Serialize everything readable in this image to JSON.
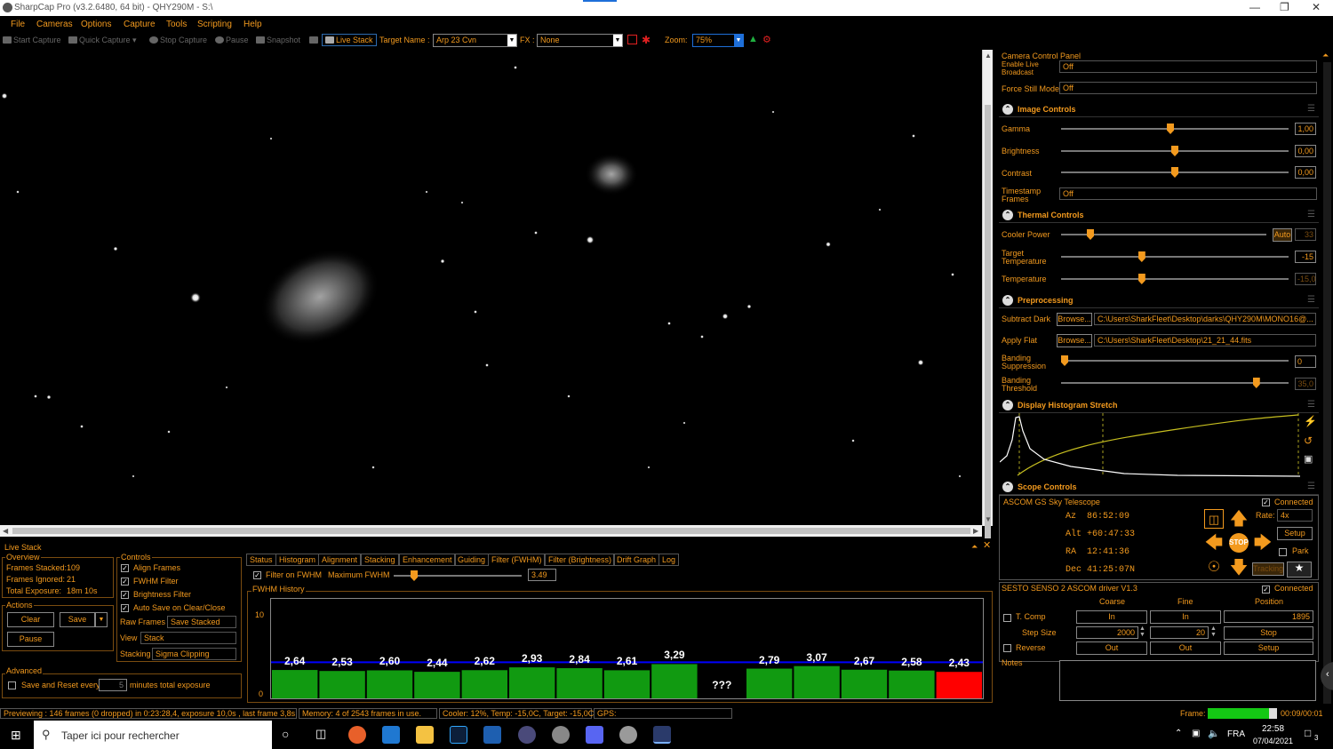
{
  "window": {
    "title": "SharpCap Pro (v3.2.6480, 64 bit) - QHY290M - S:\\"
  },
  "menu": [
    "File",
    "Cameras",
    "Options",
    "Capture",
    "Tools",
    "Scripting",
    "Help"
  ],
  "toolbar": {
    "start_capture": "Start Capture",
    "quick_capture": "Quick Capture",
    "stop_capture": "Stop Capture",
    "pause": "Pause",
    "snapshot": "Snapshot",
    "live_stack": "Live Stack",
    "target_label": "Target Name :",
    "target_value": "Arp 23 Cvn",
    "fx_label": "FX :",
    "fx_value": "None",
    "zoom_label": "Zoom:",
    "zoom_value": "75%"
  },
  "camera_panel": {
    "title": "Camera Control Panel",
    "live_broadcast_label": "Enable Live Broadcast",
    "live_broadcast_value": "Off",
    "force_still_label": "Force Still Mode",
    "force_still_value": "Off",
    "image_controls": {
      "title": "Image Controls",
      "gamma_label": "Gamma",
      "gamma_value": "1,00",
      "gamma_level": 0.48,
      "brightness_label": "Brightness",
      "brightness_value": "0,00",
      "brightness_level": 0.5,
      "contrast_label": "Contrast",
      "contrast_value": "0,00",
      "contrast_level": 0.5,
      "timestamp_label": "Timestamp Frames",
      "timestamp_value": "Off"
    },
    "thermal": {
      "title": "Thermal Controls",
      "cooler_label": "Cooler Power",
      "cooler_auto": "Auto",
      "cooler_value": "33",
      "cooler_level": 0.13,
      "target_label": "Target Temperature",
      "target_value": "-15",
      "target_level": 0.35,
      "temp_label": "Temperature",
      "temp_value": "-15,0",
      "temp_level": 0.35
    },
    "preprocessing": {
      "title": "Preprocessing",
      "dark_label": "Subtract Dark",
      "browse": "Browse...",
      "dark_path": "C:\\Users\\SharkFleet\\Desktop\\darks\\QHY290M\\MONO16@...",
      "flat_label": "Apply Flat",
      "flat_path": "C:\\Users\\SharkFleet\\Desktop\\21_21_44.fits",
      "banding_label": "Banding Suppression",
      "banding_value": "0",
      "banding_level": 0.0,
      "threshold_label": "Banding Threshold",
      "threshold_value": "35,0",
      "threshold_level": 0.87
    },
    "histogram": {
      "title": "Display Histogram Stretch"
    },
    "scope": {
      "title": "Scope Controls",
      "name": "ASCOM GS Sky Telescope",
      "connected": "Connected",
      "az": "Az  86:52:09",
      "alt": "Alt +60:47:33",
      "ra": "RA  12:41:36",
      "dec": "Dec 41:25:07N",
      "rate_label": "Rate:",
      "rate_value": "4x",
      "setup": "Setup",
      "park": "Park",
      "tracking": "Tracking",
      "stop": "STOP"
    },
    "focuser": {
      "name": "SESTO SENSO 2 ASCOM driver V1.3",
      "connected": "Connected",
      "coarse": "Coarse",
      "fine": "Fine",
      "position": "Position",
      "tcomp": "T. Comp",
      "in": "In",
      "position_value": "1895",
      "step_label": "Step Size",
      "coarse_step": "2000",
      "fine_step": "20",
      "stop": "Stop",
      "reverse": "Reverse",
      "out": "Out",
      "setup": "Setup",
      "notes": "Notes"
    }
  },
  "live_stack": {
    "title": "Live Stack",
    "overview": {
      "title": "Overview",
      "stacked_label": "Frames Stacked:",
      "stacked": "109",
      "ignored_label": "Frames Ignored:",
      "ignored": "21",
      "exposure_label": "Total Exposure:",
      "exposure": "18m 10s"
    },
    "actions": {
      "title": "Actions",
      "clear": "Clear",
      "save": "Save",
      "pause": "Pause"
    },
    "advanced": {
      "title": "Advanced",
      "save_reset": "Save and Reset every",
      "minutes_value": "5",
      "minutes_label": "minutes total exposure"
    },
    "controls": {
      "title": "Controls",
      "align": "Align Frames",
      "fwhm": "FWHM Filter",
      "brightness": "Brightness Filter",
      "autosave": "Auto Save on Clear/Close",
      "raw_label": "Raw Frames",
      "raw_value": "Save Stacked",
      "view_label": "View",
      "view_value": "Stack",
      "stacking_label": "Stacking",
      "stacking_value": "Sigma Clipping"
    },
    "tabs": [
      "Status",
      "Histogram",
      "Alignment",
      "Stacking",
      "Enhancement",
      "Guiding",
      "Filter (FWHM)",
      "Filter (Brightness)",
      "Drift Graph",
      "Log"
    ],
    "filter_on_fwhm": "Filter on FWHM",
    "max_fwhm_label": "Maximum FWHM",
    "max_fwhm_value": "3.49",
    "history_title": "FWHM History"
  },
  "chart_data": {
    "type": "bar",
    "title": "FWHM History",
    "ylim": [
      0,
      10
    ],
    "y_ticks": [
      "10",
      "0"
    ],
    "threshold": 3.49,
    "values": [
      2.64,
      2.53,
      2.6,
      2.44,
      2.62,
      2.93,
      2.84,
      2.61,
      3.29,
      null,
      2.79,
      3.07,
      2.67,
      2.58,
      2.43
    ],
    "labels": [
      "2,64",
      "2,53",
      "2,60",
      "2,44",
      "2,62",
      "2,93",
      "2,84",
      "2,61",
      "3,29",
      "???",
      "2,79",
      "3,07",
      "2,67",
      "2,58",
      "2,43"
    ],
    "colors": [
      "#119a11",
      "#119a11",
      "#119a11",
      "#119a11",
      "#119a11",
      "#119a11",
      "#119a11",
      "#119a11",
      "#119a11",
      "none",
      "#119a11",
      "#119a11",
      "#119a11",
      "#119a11",
      "#ff0000"
    ]
  },
  "status": {
    "preview": "Previewing : 146 frames (0 dropped) in 0:23:28,4, exposure 10,0s , last frame 3,8s",
    "memory": "Memory: 4 of 2543 frames in use.",
    "cooler": "Cooler: 12%, Temp: -15,0C, Target: -15,0C",
    "gps": "GPS:",
    "frame_label": "Frame:",
    "frame_time": "00:09/00:01",
    "frame_progress": 0.88
  },
  "taskbar": {
    "search_placeholder": "Taper ici pour rechercher",
    "lang": "FRA",
    "time": "22:58",
    "date": "07/04/2021",
    "notif": "3"
  },
  "colors": {
    "accent": "#f39a1e",
    "bar_ok": "#119a11",
    "bar_bad": "#ff0000",
    "chart_line": "#0000ff"
  }
}
